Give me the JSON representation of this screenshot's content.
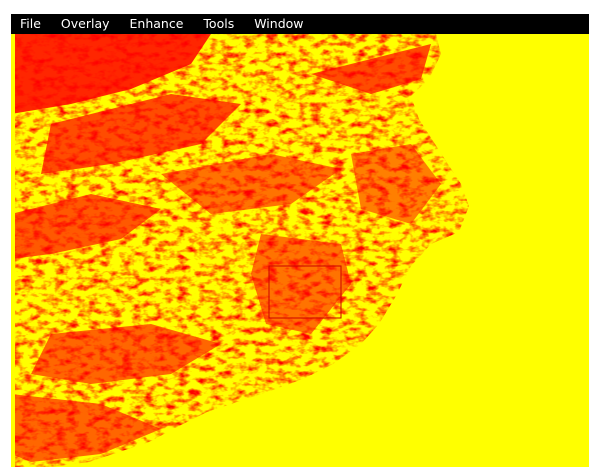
{
  "menubar": {
    "items": [
      {
        "label": "File"
      },
      {
        "label": "Overlay"
      },
      {
        "label": "Enhance"
      },
      {
        "label": "Tools"
      },
      {
        "label": "Window"
      }
    ]
  },
  "image": {
    "description_icon": "classified-raster-image",
    "colors": {
      "background": "#ffff00",
      "foreground": "#ff0000",
      "menubar": "#000000",
      "menu_text": "#ffffff"
    }
  }
}
